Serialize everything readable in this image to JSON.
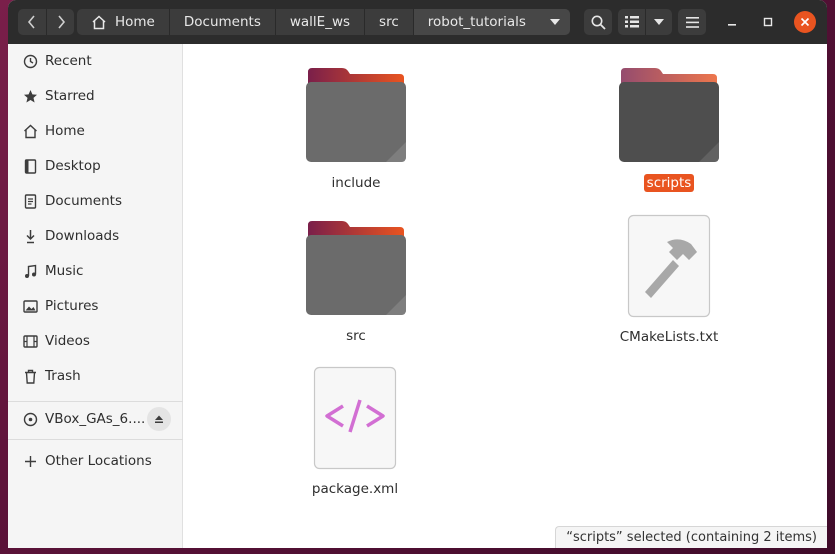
{
  "header": {
    "breadcrumbs": [
      "Home",
      "Documents",
      "wallE_ws",
      "src",
      "robot_tutorials"
    ]
  },
  "sidebar": {
    "items": [
      {
        "label": "Recent",
        "icon": "clock-icon"
      },
      {
        "label": "Starred",
        "icon": "star-icon"
      },
      {
        "label": "Home",
        "icon": "home-icon"
      },
      {
        "label": "Desktop",
        "icon": "desktop-icon"
      },
      {
        "label": "Documents",
        "icon": "document-icon"
      },
      {
        "label": "Downloads",
        "icon": "download-icon"
      },
      {
        "label": "Music",
        "icon": "music-icon"
      },
      {
        "label": "Pictures",
        "icon": "picture-icon"
      },
      {
        "label": "Videos",
        "icon": "video-icon"
      },
      {
        "label": "Trash",
        "icon": "trash-icon"
      }
    ],
    "device": {
      "label": "VBox_GAs_6....",
      "icon": "disc-icon"
    },
    "other": {
      "label": "Other Locations",
      "icon": "plus-icon"
    }
  },
  "files": [
    {
      "name": "include",
      "type": "folder",
      "selected": false
    },
    {
      "name": "scripts",
      "type": "folder",
      "selected": true
    },
    {
      "name": "src",
      "type": "folder",
      "selected": false
    },
    {
      "name": "CMakeLists.txt",
      "type": "text-file",
      "selected": false
    },
    {
      "name": "package.xml",
      "type": "xml-file",
      "selected": false
    }
  ],
  "status": "“scripts” selected  (containing 2 items)",
  "colors": {
    "accent": "#e95420",
    "folder_dark": "#5d5d5d",
    "folder_tab": "#8b2355"
  }
}
